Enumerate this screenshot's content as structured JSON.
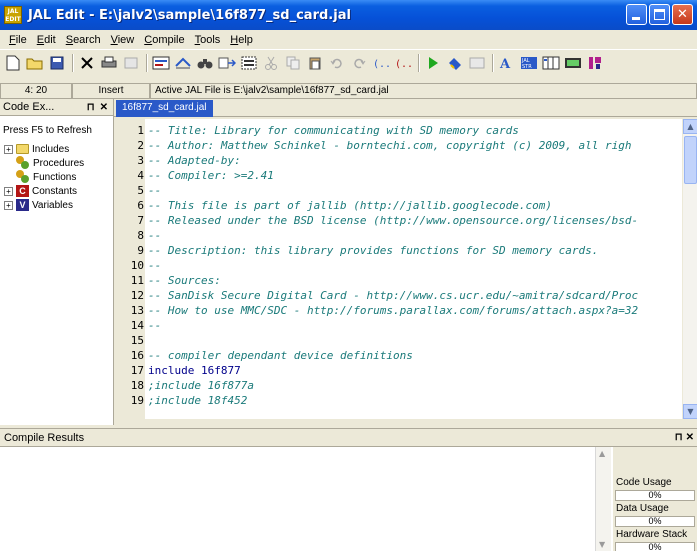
{
  "window": {
    "title": "JAL Edit - E:\\jalv2\\sample\\16f877_sd_card.jal",
    "app_icon_text": "JAL EDIT"
  },
  "menu": [
    "File",
    "Edit",
    "Search",
    "View",
    "Compile",
    "Tools",
    "Help"
  ],
  "toolbar_icons": [
    "new-file-icon",
    "open-folder-icon",
    "save-icon",
    "close-icon",
    "print-icon",
    "print-preview-icon",
    "find-icon",
    "replace-icon",
    "binoculars-icon",
    "goto-line-icon",
    "select-all-icon",
    "cut-icon",
    "copy-icon",
    "paste-icon",
    "undo-icon",
    "redo-icon",
    "bracket-icon",
    "bracket-match-icon",
    "compile-run-icon",
    "program-icon",
    "disabled-icon",
    "font-icon",
    "jal-strings-icon",
    "columns-icon",
    "ascii-table-icon",
    "magenta-tool-icon"
  ],
  "status": {
    "position": "4: 20",
    "mode": "Insert",
    "active_file": "Active JAL File is E:\\jalv2\\sample\\16f877_sd_card.jal"
  },
  "code_explorer": {
    "header": "Code Ex...",
    "pin": "⊓",
    "close": "✕",
    "refresh_hint": "Press F5 to Refresh",
    "items": [
      {
        "label": "Includes",
        "expandable": true,
        "icon": "folder-icon"
      },
      {
        "label": "Procedures",
        "expandable": false,
        "icon": "procedure-icon"
      },
      {
        "label": "Functions",
        "expandable": false,
        "icon": "function-icon"
      },
      {
        "label": "Constants",
        "expandable": true,
        "icon": "constant-icon",
        "glyph": "C"
      },
      {
        "label": "Variables",
        "expandable": true,
        "icon": "variable-icon",
        "glyph": "V"
      }
    ]
  },
  "editor": {
    "tab": "16f877_sd_card.jal",
    "lines": [
      {
        "n": "1",
        "text": "-- Title: Library for communicating with SD memory cards",
        "kind": "comment"
      },
      {
        "n": "2",
        "text": "-- Author: Matthew Schinkel - borntechi.com, copyright (c) 2009, all righ",
        "kind": "comment"
      },
      {
        "n": "3",
        "text": "-- Adapted-by:",
        "kind": "comment"
      },
      {
        "n": "4",
        "text": "-- Compiler: >=2.41",
        "kind": "comment"
      },
      {
        "n": "5",
        "text": "--",
        "kind": "comment"
      },
      {
        "n": "6",
        "text": "-- This file is part of jallib (http://jallib.googlecode.com)",
        "kind": "comment"
      },
      {
        "n": "7",
        "text": "-- Released under the BSD license (http://www.opensource.org/licenses/bsd-",
        "kind": "comment"
      },
      {
        "n": "8",
        "text": "--",
        "kind": "comment"
      },
      {
        "n": "9",
        "text": "-- Description: this library provides functions for SD memory cards.",
        "kind": "comment"
      },
      {
        "n": "10",
        "text": "--",
        "kind": "comment"
      },
      {
        "n": "11",
        "text": "-- Sources:",
        "kind": "comment"
      },
      {
        "n": "12",
        "text": "-- SanDisk Secure Digital Card - http://www.cs.ucr.edu/~amitra/sdcard/Proc",
        "kind": "comment"
      },
      {
        "n": "13",
        "text": "-- How to use MMC/SDC - http://forums.parallax.com/forums/attach.aspx?a=32",
        "kind": "comment"
      },
      {
        "n": "14",
        "text": "--",
        "kind": "comment"
      },
      {
        "n": "15",
        "text": "",
        "kind": "plain"
      },
      {
        "n": "16",
        "text": "-- compiler dependant device definitions",
        "kind": "comment"
      },
      {
        "n": "17",
        "text": "include 16f877",
        "kind": "keyword"
      },
      {
        "n": "18",
        "text": ";include 16f877a",
        "kind": "comment"
      },
      {
        "n": "19",
        "text": ";include 18f452",
        "kind": "comment"
      }
    ]
  },
  "compile_results": {
    "header": "Compile Results",
    "pin": "⊓",
    "close": "✕",
    "stats": [
      {
        "label": "Code Usage",
        "value": "0%"
      },
      {
        "label": "Data Usage",
        "value": "0%"
      },
      {
        "label": "Hardware Stack",
        "value": "0%"
      }
    ]
  }
}
